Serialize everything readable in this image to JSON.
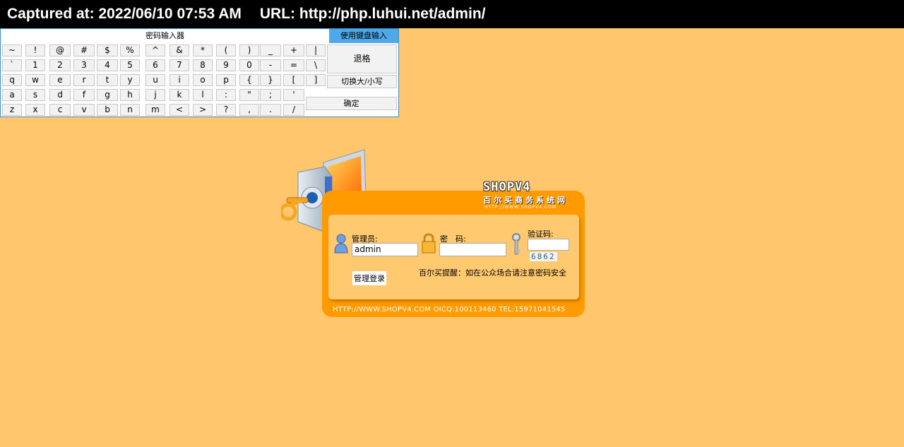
{
  "banner": {
    "captured": "Captured at: 2022/06/10 07:53 AM",
    "url": "URL: http://php.luhui.net/admin/"
  },
  "keyboard": {
    "title": "密码输入器",
    "use_keyboard": "使用键盘输入",
    "backspace": "退格",
    "toggle_case": "切换大/小写",
    "confirm": "确定",
    "rows": [
      [
        "~",
        "!",
        "@",
        "#",
        "$",
        "%",
        "^",
        "&",
        "*",
        "(",
        ")",
        "_",
        "+",
        "|"
      ],
      [
        "`",
        "1",
        "2",
        "3",
        "4",
        "5",
        "6",
        "7",
        "8",
        "9",
        "0",
        "-",
        "=",
        "\\"
      ],
      [
        "q",
        "w",
        "e",
        "r",
        "t",
        "y",
        "u",
        "i",
        "o",
        "p",
        "{",
        "}",
        "[",
        "]"
      ],
      [
        "a",
        "s",
        "d",
        "f",
        "g",
        "h",
        "j",
        "k",
        "l",
        ":",
        "\"",
        ";",
        "'"
      ],
      [
        "z",
        "x",
        "c",
        "v",
        "b",
        "n",
        "m",
        "<",
        ">",
        "?",
        ",",
        ".",
        "/"
      ]
    ]
  },
  "login": {
    "brand": "SHOPV4",
    "brand_sub": "百尔买商务系统网",
    "brand_url": "HTTP://WWW.SHOPV4.COM",
    "admin_label": "管理员:",
    "admin_value": "admin",
    "password_label": "密　码:",
    "captcha_label": "验证码:",
    "captcha_value": "6862",
    "submit": "管理登录",
    "tip": "百尔买提醒：如在公众场合请注意密码安全",
    "footer": "HTTP://WWW.SHOPV4.COM  OICQ:100113460  TEL:15971041545"
  }
}
